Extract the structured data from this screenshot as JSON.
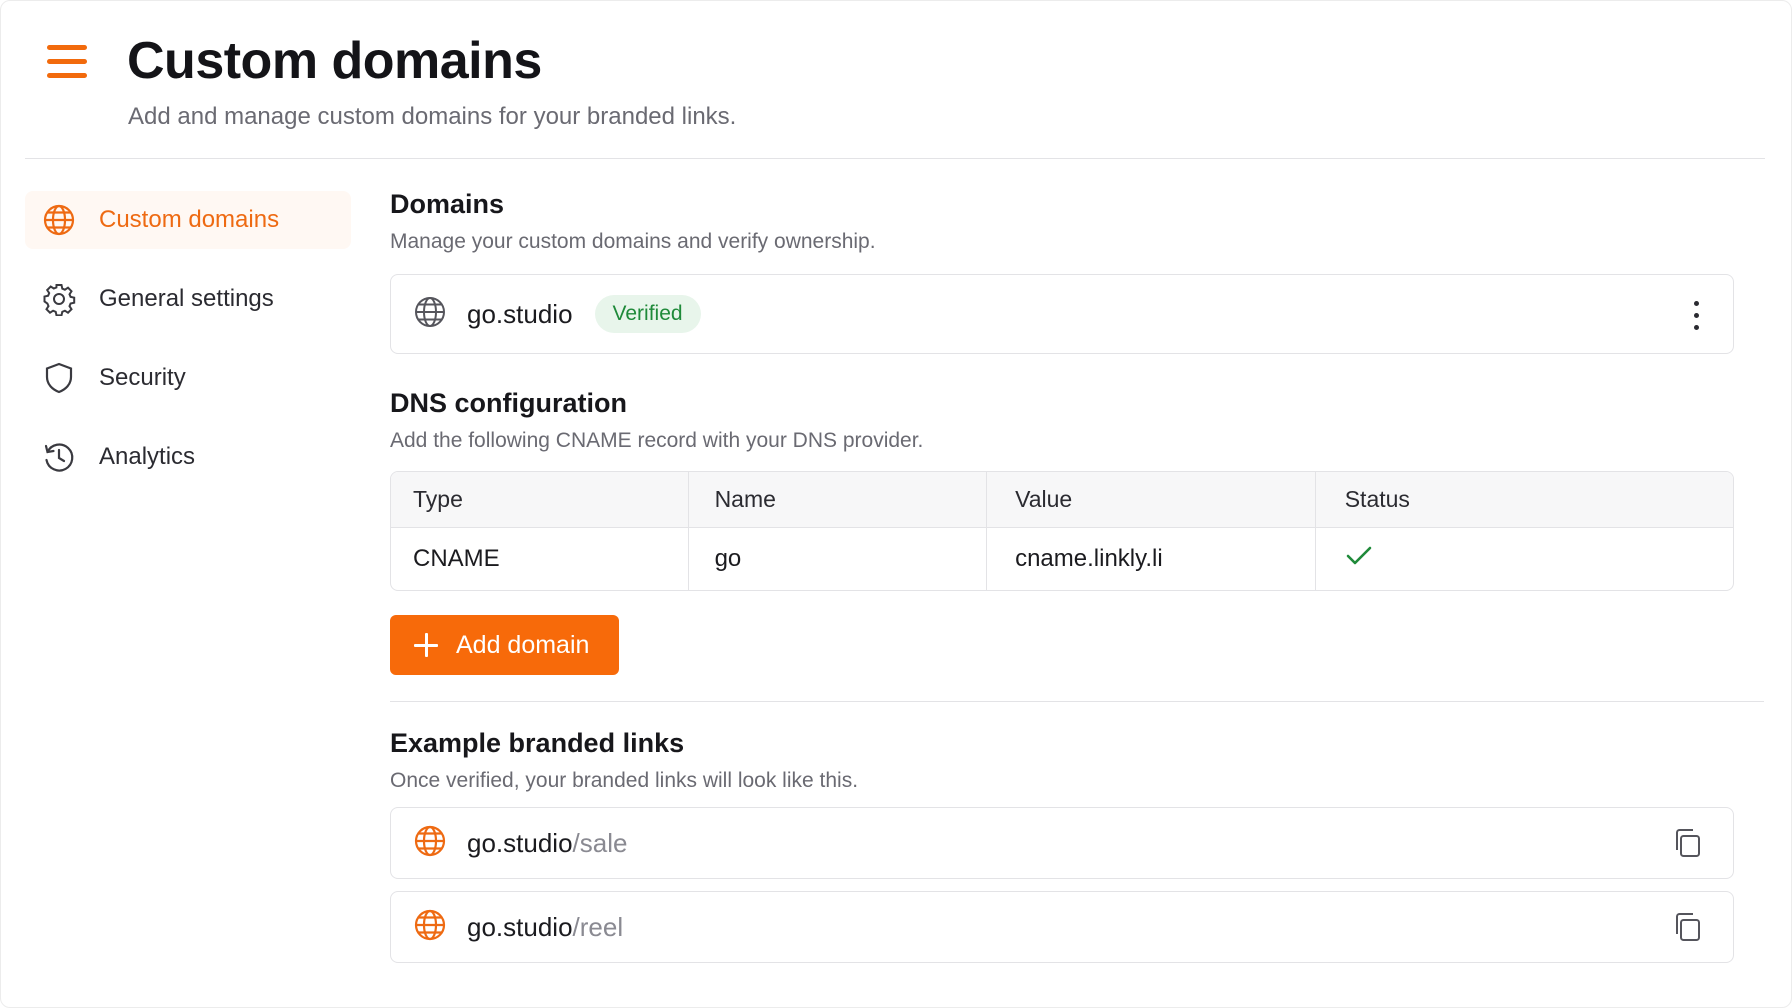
{
  "header": {
    "title": "Custom domains",
    "subtitle": "Add and manage custom domains for your branded links."
  },
  "sidebar": {
    "items": [
      {
        "label": "Custom domains",
        "icon": "globe-icon",
        "active": true
      },
      {
        "label": "General settings",
        "icon": "gear-icon",
        "active": false
      },
      {
        "label": "Security",
        "icon": "shield-icon",
        "active": false
      },
      {
        "label": "Analytics",
        "icon": "history-icon",
        "active": false
      }
    ]
  },
  "domains": {
    "title": "Domains",
    "subtitle": "Manage your custom domains and verify ownership.",
    "items": [
      {
        "name": "go.studio",
        "status": "Verified"
      }
    ]
  },
  "dns": {
    "title": "DNS configuration",
    "subtitle": "Add the following CNAME record with your DNS provider.",
    "columns": [
      "Type",
      "Name",
      "Value",
      "Status"
    ],
    "rows": [
      {
        "type": "CNAME",
        "name": "go",
        "value": "cname.linkly.li",
        "status": "check-icon"
      }
    ]
  },
  "actions": {
    "add_domain_label": "Add domain"
  },
  "examples": {
    "title": "Example branded links",
    "subtitle": "Once verified, your branded links will look like this.",
    "links": [
      {
        "domain": "go.studio",
        "path": "/sale"
      },
      {
        "domain": "go.studio",
        "path": "/reel"
      }
    ]
  },
  "colors": {
    "accent": "#f76a0a",
    "verified_bg": "#e8f5eb",
    "verified_text": "#1f8a3a"
  }
}
